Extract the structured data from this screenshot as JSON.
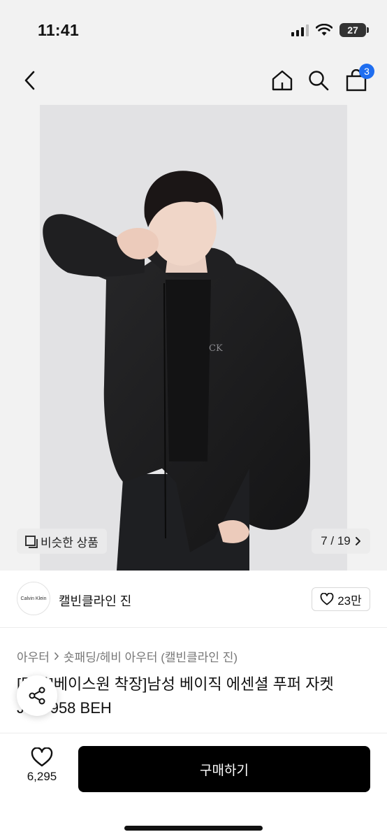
{
  "status_bar": {
    "time": "11:41",
    "battery": "27"
  },
  "nav": {
    "cart_count": "3"
  },
  "gallery": {
    "similar_label": "비슷한 상품",
    "page_indicator": "7 / 19",
    "watermark_brand_text": "CK"
  },
  "brand": {
    "logo_text": "Calvin Klein",
    "name": "캘빈클라인 진",
    "likes": "23만"
  },
  "breadcrumb": {
    "category": "아우터",
    "subcategory": "숏패딩/헤비 아우터 (캘빈클라인 진)"
  },
  "product": {
    "title": "[단독]베이스원 착장]남성 베이직 에센셜 푸퍼 자켓 J326958 BEH"
  },
  "bottom_bar": {
    "wish_count": "6,295",
    "buy_label": "구매하기"
  },
  "colors": {
    "accent_badge": "#1f6ef0",
    "buy_button": "#000000"
  }
}
